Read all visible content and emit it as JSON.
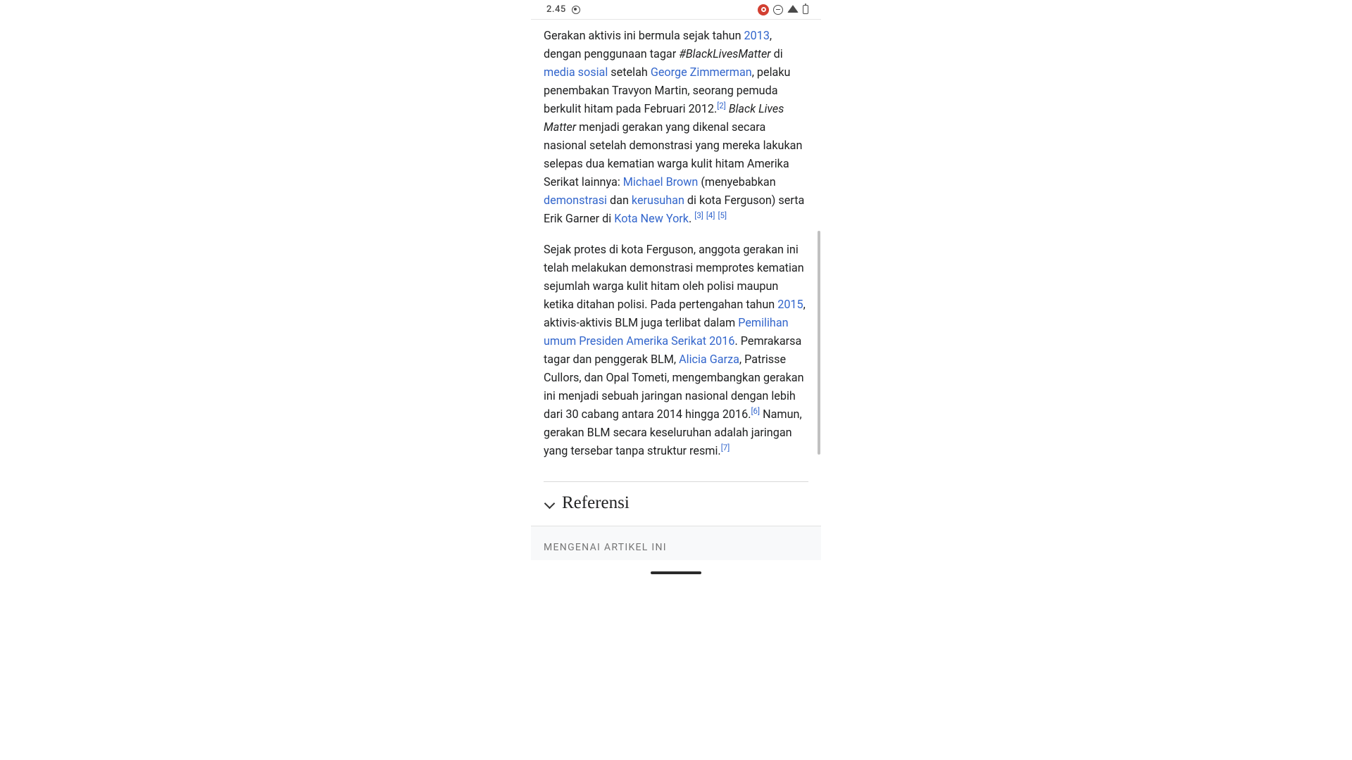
{
  "status": {
    "time": "2.45"
  },
  "para1": {
    "t1": "Gerakan aktivis ini bermula sejak tahun ",
    "link_2013": "2013",
    "t2": ", dengan penggunaan tagar ",
    "hashtag": "#BlackLivesMatter",
    "t3": " di ",
    "link_media": "media sosial",
    "t4": " setelah ",
    "link_zimmer": "George Zimmerman",
    "t5": ", pelaku penembakan Travyon Martin, seorang pemuda berkulit hitam pada Februari 2012.",
    "ref2": "[2]",
    "blm_name": "Black Lives Matter",
    "t6": " menjadi gerakan yang dikenal secara nasional setelah demonstrasi yang mereka lakukan selepas dua kematian warga kulit hitam Amerika Serikat lainnya: ",
    "link_brown": "Michael Brown",
    "t7": " (menyebabkan ",
    "link_demo": "demonstrasi",
    "t8": " dan ",
    "link_riot": "kerusuhan",
    "t9": " di kota Ferguson) serta Erik Garner di ",
    "link_nyc": "Kota New York",
    "t10": ". ",
    "ref3": "[3]",
    "ref4": "[4]",
    "ref5": "[5]"
  },
  "para2": {
    "t1": "Sejak protes di kota Ferguson, anggota gerakan ini telah melakukan demonstrasi memprotes kematian sejumlah warga kulit hitam oleh polisi maupun ketika ditahan polisi. Pada pertengahan tahun ",
    "link_2015": "2015",
    "t2": ", aktivis-aktivis BLM juga terlibat dalam ",
    "link_election": "Pemilihan umum Presiden Amerika Serikat 2016",
    "t3": ". Pemrakarsa tagar dan penggerak BLM, ",
    "link_garza": "Alicia Garza",
    "t4": ", Patrisse Cullors, dan Opal Tometi, mengembangkan gerakan ini menjadi sebuah jaringan nasional dengan lebih dari 30 cabang antara 2014 hingga 2016.",
    "ref6": "[6]",
    "t5": " Namun, gerakan BLM secara keseluruhan adalah jaringan yang tersebar tanpa struktur resmi.",
    "ref7": "[7]"
  },
  "sections": {
    "references": "Referensi"
  },
  "about": {
    "label": "MENGENAI ARTIKEL INI"
  }
}
